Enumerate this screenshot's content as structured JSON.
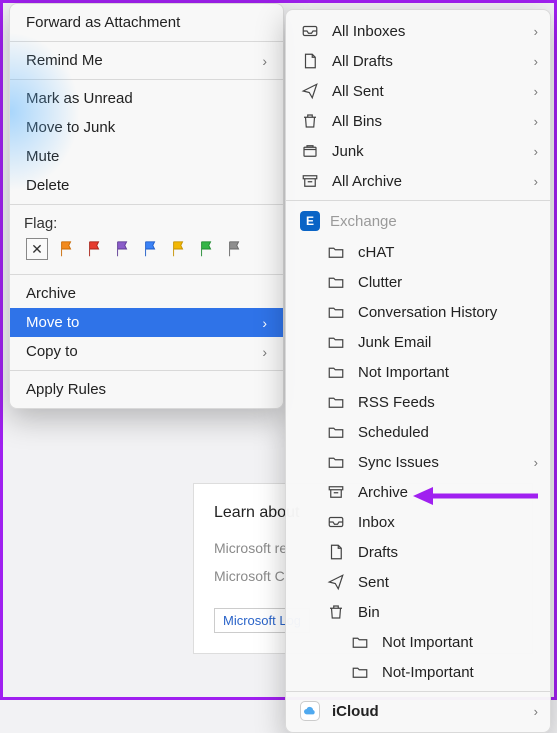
{
  "bg": {
    "heading": "Learn about",
    "line1": "Microsoft re",
    "line2": "Microsoft C",
    "link": "Microsoft Log"
  },
  "leftMenu": {
    "forward": "Forward as Attachment",
    "remind": "Remind Me",
    "markUnread": "Mark as Unread",
    "moveJunk": "Move to Junk",
    "mute": "Mute",
    "delete": "Delete",
    "flagLabel": "Flag:",
    "archive": "Archive",
    "moveTo": "Move to",
    "copyTo": "Copy to",
    "applyRules": "Apply Rules"
  },
  "flags": {
    "colors": [
      "#f28a1e",
      "#e63b2e",
      "#8a5cc9",
      "#3b82f6",
      "#f2b705",
      "#35b547",
      "#8e8e8e"
    ]
  },
  "rightMenu": {
    "allInboxes": "All Inboxes",
    "allDrafts": "All Drafts",
    "allSent": "All Sent",
    "allBins": "All Bins",
    "junk": "Junk",
    "allArchive": "All Archive",
    "exchange": "Exchange",
    "folders": {
      "chat": "cHAT",
      "clutter": "Clutter",
      "convHist": "Conversation History",
      "junkEmail": "Junk Email",
      "notImportant": "Not Important",
      "rss": "RSS Feeds",
      "scheduled": "Scheduled",
      "syncIssues": "Sync Issues",
      "archive": "Archive",
      "inbox": "Inbox",
      "drafts": "Drafts",
      "sent": "Sent",
      "bin": "Bin",
      "notImportant2": "Not Important",
      "notImportant3": "Not-Important"
    },
    "icloud": "iCloud"
  }
}
